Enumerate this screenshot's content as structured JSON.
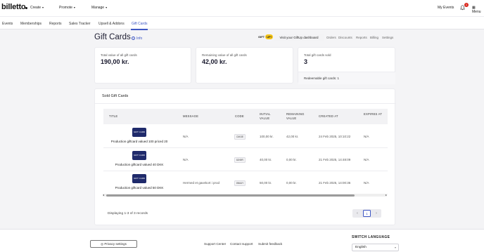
{
  "header": {
    "logo": "billetto",
    "nav": [
      {
        "label": "Create"
      },
      {
        "label": "Promote"
      },
      {
        "label": "Manage"
      }
    ],
    "my_events": "My Events",
    "notification_count": "1",
    "menu": "Menu"
  },
  "subnav": {
    "items": [
      "Events",
      "Memberships",
      "Reports",
      "Sales Tracker",
      "Upsell & Addons",
      "Gift Cards"
    ],
    "active": "Gift Cards"
  },
  "page": {
    "title": "Gift Cards",
    "info_label": "Info",
    "giftup_logo": "GIFT",
    "giftup_logo_up": "UP!",
    "dashboard_button": "Visit your GiftUp dashboard",
    "giftup_links": [
      "Orders",
      "Discounts",
      "Reports",
      "Billing",
      "Settings"
    ]
  },
  "stats": {
    "total_value_label": "Total value of all gift cards",
    "total_value": "190,00 kr.",
    "remaining_value_label": "Remaining value of all gift cards",
    "remaining_value": "42,00 kr.",
    "total_sold_label": "Total gift cards sold",
    "total_sold": "3",
    "redeemable_label": "Redeemable gift cards: 1"
  },
  "sold": {
    "title": "Sold Gift Cards",
    "columns": [
      "Title",
      "Message",
      "Code",
      "Initial value",
      "Remaining value",
      "Created at",
      "Expires at"
    ],
    "rows": [
      {
        "thumb": "GIFT CARD",
        "title": "Production giftcard valued 100 priced 20",
        "message": "N/A",
        "code": "C6K3E",
        "initial": "100,00 kr.",
        "remaining": "42,00 kr.",
        "created": "24 Feb 2025, 10:10:22",
        "expires": "N/A"
      },
      {
        "thumb": "GIFT CARD",
        "title": "Production giftcard valued 40 DKK",
        "message": "N/A",
        "code": "8JN9R",
        "initial": "40,00 kr.",
        "remaining": "0,00 kr.",
        "created": "21 Feb 2025, 14:48:09",
        "expires": "N/A"
      },
      {
        "thumb": "GIFT CARD",
        "title": "Production giftcard valued 50 DKK",
        "message": "Hermed et gavekort i prod",
        "code": "8N6UY",
        "initial": "50,00 kr.",
        "remaining": "0,00 kr.",
        "created": "21 Feb 2025, 14:00:36",
        "expires": "N/A"
      }
    ],
    "displaying": "Displaying 1-3 of 3 records",
    "current_page": "1"
  },
  "footer": {
    "privacy": "Privacy settings",
    "links": [
      "Support Center",
      "Contact support",
      "Submit feedback"
    ],
    "switch_language": "SWITCH LANGUAGE",
    "language": "English"
  },
  "colors": {
    "accent": "#3d56c4",
    "giftup_yellow": "#f5c518",
    "notification_red": "#d9261c",
    "thumb_navy": "#1f2a6b"
  }
}
